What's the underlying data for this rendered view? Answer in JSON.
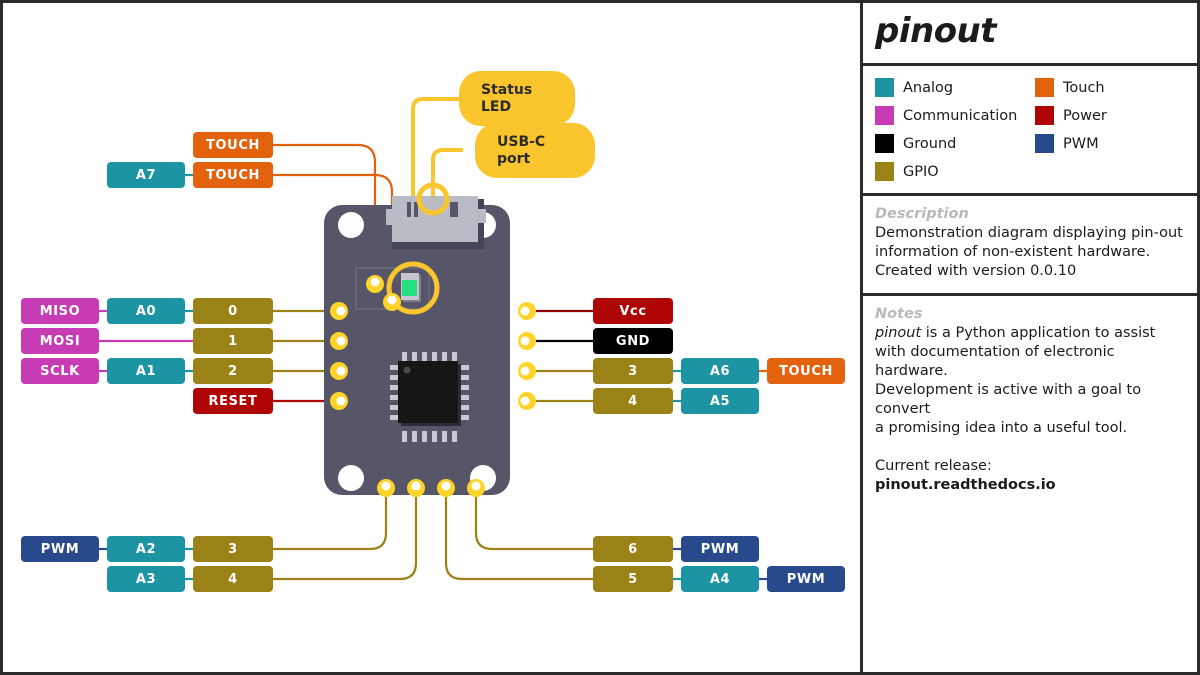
{
  "panel": {
    "title": "pinout",
    "legend": {
      "items": [
        {
          "label": "Analog",
          "color": "#1d94a3"
        },
        {
          "label": "Touch",
          "color": "#e2620d"
        },
        {
          "label": "Communication",
          "color": "#c73cb4"
        },
        {
          "label": "Power",
          "color": "#b00505"
        },
        {
          "label": "Ground",
          "color": "#000000"
        },
        {
          "label": "PWM",
          "color": "#284a8c"
        },
        {
          "label": "GPIO",
          "color": "#9a8217"
        }
      ]
    },
    "description": {
      "heading": "Description",
      "line1": "Demonstration diagram displaying pin-out",
      "line2": "information of non-existent hardware.",
      "line3": "Created with version 0.0.10"
    },
    "notes": {
      "heading": "Notes",
      "app_name": "pinout",
      "line1_rest": " is a Python application to assist",
      "line2": "with documentation of electronic hardware.",
      "line3": "Development is active with a goal to convert",
      "line4": "a promising idea into a useful tool.",
      "release_heading": "Current release:",
      "release_url": "pinout.readthedocs.io"
    }
  },
  "diagram": {
    "annotations": [
      {
        "name": "status-led",
        "line1": "Status",
        "line2": "LED"
      },
      {
        "name": "usb-c-port",
        "line1": "USB-C",
        "line2": "port"
      }
    ],
    "left_top_labels": [
      {
        "text": "TOUCH",
        "color": "#e2620d"
      },
      {
        "text": "A7",
        "color": "#1d94a3"
      },
      {
        "text": "TOUCH",
        "color": "#e2620d"
      }
    ],
    "left_pin_rows": [
      {
        "pin": "0",
        "pin_color": "#9a8217",
        "mid": "A0",
        "mid_color": "#1d94a3",
        "outer": "MISO",
        "outer_color": "#c73cb4"
      },
      {
        "pin": "1",
        "pin_color": "#9a8217",
        "mid": "",
        "mid_color": "",
        "outer": "MOSI",
        "outer_color": "#c73cb4"
      },
      {
        "pin": "2",
        "pin_color": "#9a8217",
        "mid": "A1",
        "mid_color": "#1d94a3",
        "outer": "SCLK",
        "outer_color": "#c73cb4"
      },
      {
        "pin": "RESET",
        "pin_color": "#b00505",
        "mid": "",
        "mid_color": "",
        "outer": "",
        "outer_color": ""
      }
    ],
    "right_pin_rows": [
      {
        "pin": "Vcc",
        "pin_color": "#b00505",
        "mid": "",
        "mid_color": "",
        "outer": "",
        "outer_color": ""
      },
      {
        "pin": "GND",
        "pin_color": "#000000",
        "mid": "",
        "mid_color": "",
        "outer": "",
        "outer_color": ""
      },
      {
        "pin": "3",
        "pin_color": "#9a8217",
        "mid": "A6",
        "mid_color": "#1d94a3",
        "outer": "TOUCH",
        "outer_color": "#e2620d"
      },
      {
        "pin": "4",
        "pin_color": "#9a8217",
        "mid": "A5",
        "mid_color": "#1d94a3",
        "outer": "",
        "outer_color": ""
      }
    ],
    "bottom_left_rows": [
      {
        "pin": "3",
        "pin_color": "#9a8217",
        "mid": "A2",
        "mid_color": "#1d94a3",
        "outer": "PWM",
        "outer_color": "#284a8c"
      },
      {
        "pin": "4",
        "pin_color": "#9a8217",
        "mid": "A3",
        "mid_color": "#1d94a3",
        "outer": "",
        "outer_color": ""
      }
    ],
    "bottom_right_rows": [
      {
        "pin": "6",
        "pin_color": "#9a8217",
        "mid": "PWM",
        "mid_color": "#284a8c",
        "outer": "",
        "outer_color": ""
      },
      {
        "pin": "5",
        "pin_color": "#9a8217",
        "mid": "A4",
        "mid_color": "#1d94a3",
        "outer": "PWM",
        "outer_color": "#284a8c"
      }
    ],
    "board": {
      "body_color": "#565668",
      "pad_ring_color": "#ffd429",
      "led_color": "#24e07e",
      "chip_color": "#161616",
      "usb_color": "#b9bcc4"
    }
  }
}
